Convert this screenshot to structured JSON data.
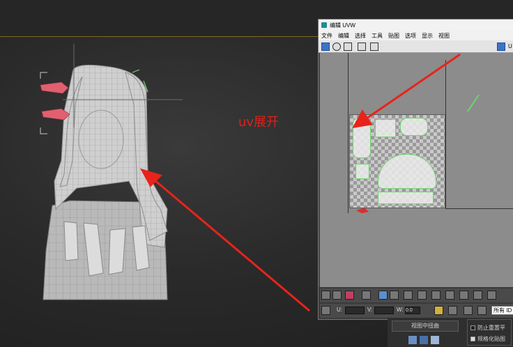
{
  "annotation": {
    "text": "uv展开"
  },
  "uvw_window": {
    "title": "编辑 UVW",
    "menu": [
      "文件",
      "编辑",
      "选择",
      "工具",
      "贴图",
      "选项",
      "显示",
      "视图"
    ],
    "toolbar_right_label": "U"
  },
  "uvw_bottom": {
    "u_label": "U:",
    "v_label": "V:",
    "w_label": "W:",
    "w_value": "0.0",
    "channel_dropdown": "所有 ID"
  },
  "right_panel": {
    "button": "视图中扭曲",
    "checkbox_1": "防止重置平",
    "checkbox_2": "规格化贴图",
    "checkbox_2_checked": true
  },
  "colors": {
    "arrow": "#e8231b",
    "seam_green": "#6fd36f",
    "accent_blue": "#3b73c8"
  }
}
